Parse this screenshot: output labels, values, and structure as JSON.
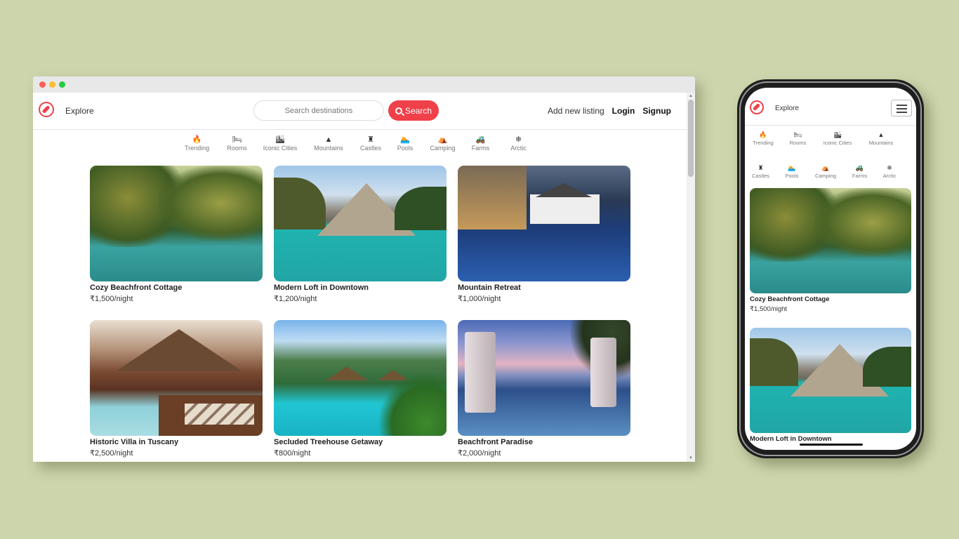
{
  "desktop": {
    "brand": "Explore",
    "search": {
      "placeholder": "Search destinations",
      "button": "Search"
    },
    "nav": {
      "add_listing": "Add new listing",
      "login": "Login",
      "signup": "Signup"
    },
    "categories": [
      {
        "icon": "fire-icon",
        "glyph": "🔥",
        "label": "Trending"
      },
      {
        "icon": "bed-icon",
        "glyph": "🛏",
        "label": "Rooms"
      },
      {
        "icon": "city-icon",
        "glyph": "🏙",
        "label": "Iconic Cities"
      },
      {
        "icon": "mountain-icon",
        "glyph": "▲",
        "label": "Mountains"
      },
      {
        "icon": "castle-icon",
        "glyph": "♜",
        "label": "Castles"
      },
      {
        "icon": "pool-icon",
        "glyph": "🏊",
        "label": "Pools"
      },
      {
        "icon": "campground-icon",
        "glyph": "⛺",
        "label": "Camping"
      },
      {
        "icon": "tractor-icon",
        "glyph": "🚜",
        "label": "Farms"
      },
      {
        "icon": "snowflake-icon",
        "glyph": "❄",
        "label": "Arctic"
      }
    ],
    "listings": [
      {
        "title": "Cozy Beachfront Cottage",
        "price": "₹1,500/night"
      },
      {
        "title": "Modern Loft in Downtown",
        "price": "₹1,200/night"
      },
      {
        "title": "Mountain Retreat",
        "price": "₹1,000/night"
      },
      {
        "title": "Historic Villa in Tuscany",
        "price": "₹2,500/night"
      },
      {
        "title": "Secluded Treehouse Getaway",
        "price": "₹800/night"
      },
      {
        "title": "Beachfront Paradise",
        "price": "₹2,000/night"
      }
    ]
  },
  "mobile": {
    "brand": "Explore",
    "categories_row1": [
      {
        "icon": "fire-icon",
        "glyph": "🔥",
        "label": "Trending"
      },
      {
        "icon": "bed-icon",
        "glyph": "🛏",
        "label": "Rooms"
      },
      {
        "icon": "city-icon",
        "glyph": "🏙",
        "label": "Iconic Cities"
      },
      {
        "icon": "mountain-icon",
        "glyph": "▲",
        "label": "Mountains"
      }
    ],
    "categories_row2": [
      {
        "icon": "castle-icon",
        "glyph": "♜",
        "label": "Castles"
      },
      {
        "icon": "pool-icon",
        "glyph": "🏊",
        "label": "Pools"
      },
      {
        "icon": "campground-icon",
        "glyph": "⛺",
        "label": "Camping"
      },
      {
        "icon": "tractor-icon",
        "glyph": "🚜",
        "label": "Farms"
      },
      {
        "icon": "snowflake-icon",
        "glyph": "❄",
        "label": "Arctic"
      }
    ],
    "listings": [
      {
        "title": "Cozy Beachfront Cottage",
        "price": "₹1,500/night"
      },
      {
        "title": "Modern Loft in Downtown",
        "price": ""
      }
    ]
  },
  "colors": {
    "accent": "#f0404a",
    "background": "#cdd5ad"
  }
}
